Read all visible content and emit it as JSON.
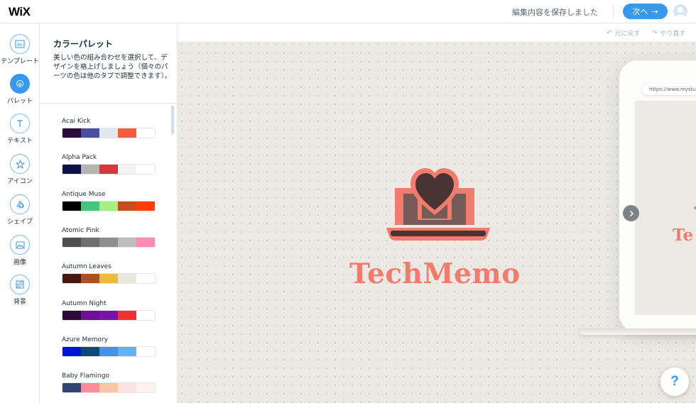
{
  "app": {
    "logo": "WiX",
    "saved_status": "編集内容を保存しました",
    "next_label": "次へ",
    "next_arrow": "→"
  },
  "rail": [
    {
      "label": "テンプレート",
      "icon": "template-icon",
      "active": false
    },
    {
      "label": "パレット",
      "icon": "palette-icon",
      "active": true
    },
    {
      "label": "テキスト",
      "icon": "text-icon",
      "active": false
    },
    {
      "label": "アイコン",
      "icon": "star-icon",
      "active": false
    },
    {
      "label": "シェイプ",
      "icon": "shapes-icon",
      "active": false
    },
    {
      "label": "画像",
      "icon": "image-icon",
      "active": false
    },
    {
      "label": "背景",
      "icon": "background-icon",
      "active": false
    }
  ],
  "panel": {
    "title": "カラーパレット",
    "description": "美しい色の組み合わせを選択して、デザインを格上げしましょう（個々のパーツの色は他のタブで調整できます）。",
    "palettes": [
      {
        "name": "Acai Kick",
        "colors": [
          "#2b0f3a",
          "#4a4ea2",
          "#e6e6f1",
          "#f55b3c",
          "#ffffff"
        ]
      },
      {
        "name": "Alpha Pack",
        "colors": [
          "#0f1145",
          "#b4b4b4",
          "#d9363a",
          "#f4f4f4",
          "#ffffff"
        ]
      },
      {
        "name": "Antique Muse",
        "colors": [
          "#000000",
          "#45c47e",
          "#a8ee84",
          "#c74c1e",
          "#ff3f06"
        ]
      },
      {
        "name": "Atomic Pink",
        "colors": [
          "#505050",
          "#6f6f6f",
          "#8f8f8f",
          "#bdbdbd",
          "#fb8cb4"
        ]
      },
      {
        "name": "Autumn Leaves",
        "colors": [
          "#4a1610",
          "#a4532b",
          "#e8bc3e",
          "#ece7db",
          "#ffffff"
        ]
      },
      {
        "name": "Autumn Night",
        "colors": [
          "#2e0a36",
          "#6d0f9b",
          "#7b13a9",
          "#f02f37",
          "#ffffff"
        ]
      },
      {
        "name": "Azure Memory",
        "colors": [
          "#0213d8",
          "#024c7c",
          "#3f94ec",
          "#5fb5fd",
          "#ffffff"
        ]
      },
      {
        "name": "Baby Flamingo",
        "colors": [
          "#34446e",
          "#fb8c98",
          "#fdc6a3",
          "#fde3df",
          "#fff1ee"
        ]
      }
    ]
  },
  "canvas": {
    "undo_label": "元に戻す",
    "redo_label": "やり直す",
    "brand_text": "TechMemo",
    "brand_color": "#f07c6e",
    "device_url": "https://www.mystunningwebsite.com",
    "device_brand": "Te",
    "help_label": "?"
  },
  "colors": {
    "accent": "#3899ec",
    "canvas_bg": "#ece9e4",
    "logo_coral": "#f07c6e",
    "logo_dark": "#4a3433"
  }
}
